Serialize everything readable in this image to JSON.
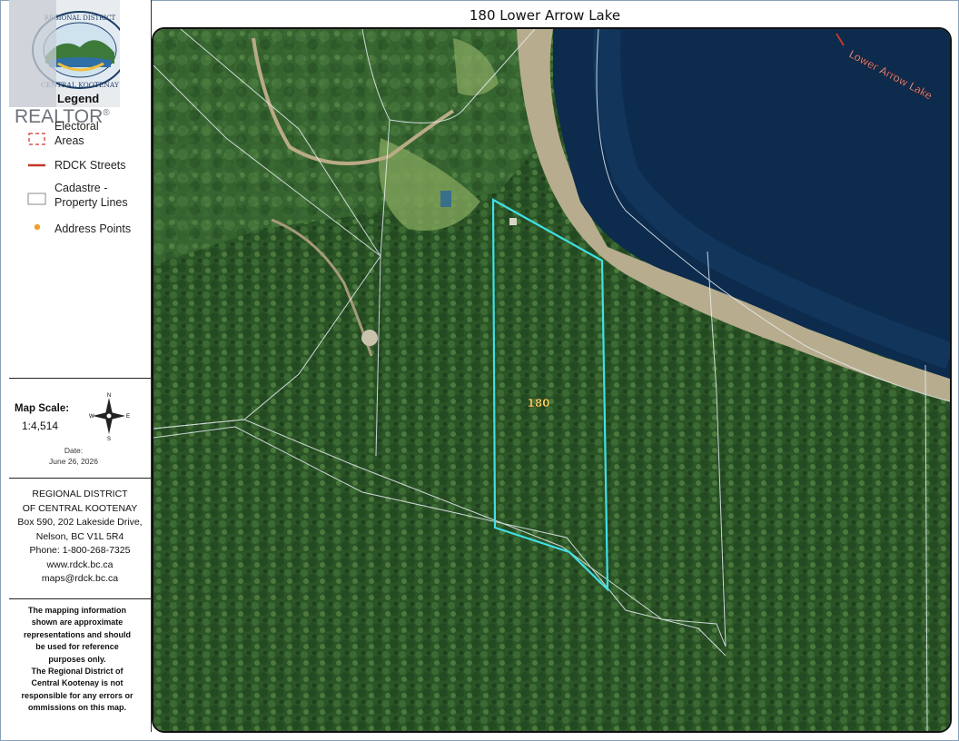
{
  "map_title": "180 Lower Arrow Lake",
  "watermark": "REALTOR",
  "watermark_mark": "®",
  "logo": {
    "text_top": "REGIONAL DISTRICT",
    "text_bottom": "CENTRAL KOOTENAY"
  },
  "legend": {
    "title": "Legend",
    "items": [
      {
        "label_line1": "Electoral",
        "label_line2": "Areas",
        "symbol": "red-dashed-box",
        "color": "#d9534f"
      },
      {
        "label_line1": "RDCK Streets",
        "label_line2": "",
        "symbol": "red-line",
        "color": "#c0392b"
      },
      {
        "label_line1": "Cadastre -",
        "label_line2": "Property Lines",
        "symbol": "white-box",
        "color": "#ffffff"
      },
      {
        "label_line1": "Address Points",
        "label_line2": "",
        "symbol": "orange-dot",
        "color": "#f0a030"
      }
    ]
  },
  "scale": {
    "label": "Map Scale:",
    "value": "1:4,514",
    "compass": {
      "n": "N",
      "s": "S",
      "e": "E",
      "w": "W"
    }
  },
  "date": {
    "label": "Date:",
    "value": "June 26, 2026"
  },
  "contact": {
    "lines": [
      "REGIONAL DISTRICT",
      "OF CENTRAL KOOTENAY",
      "Box 590, 202 Lakeside Drive,",
      "Nelson, BC  V1L 5R4",
      "Phone: 1-800-268-7325",
      "www.rdck.bc.ca",
      "maps@rdck.bc.ca"
    ]
  },
  "disclaimer": {
    "lines": [
      "The mapping information",
      "shown are approximate",
      "representations and should",
      "be used for reference",
      "purposes only.",
      "The Regional District of",
      "Central Kootenay is not",
      "responsible for any errors or",
      "ommissions on this map."
    ]
  },
  "map": {
    "lake_label": "Lower Arrow Lake",
    "parcel_label": "180",
    "parcel_color": "#3fe0e6",
    "lake_color": "#0b2a4a",
    "forest_color": "#2f5a2a"
  }
}
